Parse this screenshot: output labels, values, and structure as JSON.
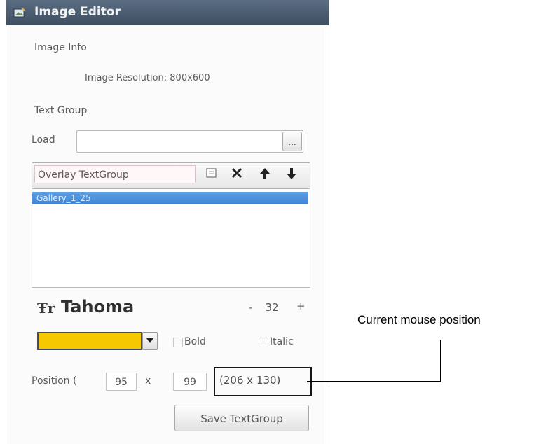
{
  "window": {
    "title": "Image Editor"
  },
  "image_info": {
    "section_label": "Image Info",
    "resolution_text": "Image Resolution: 800x600"
  },
  "text_group": {
    "section_label": "Text Group",
    "load_label": "Load",
    "load_value": "",
    "browse_label": "..."
  },
  "list": {
    "overlay_select": "Overlay TextGroup",
    "items": [
      "Gallery_1_25"
    ]
  },
  "font": {
    "name": "Tahoma",
    "size": "32",
    "minus_glyph": "-",
    "plus_glyph": "+"
  },
  "style": {
    "color_hex": "#f5c800",
    "bold_label": "Bold",
    "italic_label": "Italic"
  },
  "position": {
    "label": "Position (",
    "x_value": "95",
    "separator": "x",
    "y_value": "99",
    "mouse_readout": "(206 x 130)"
  },
  "save_button": "Save TextGroup",
  "callout": {
    "text": "Current mouse position"
  },
  "colors": {
    "titlebar": "#4b5d72",
    "selection": "#4a8fdc",
    "swatch": "#f5c800"
  }
}
